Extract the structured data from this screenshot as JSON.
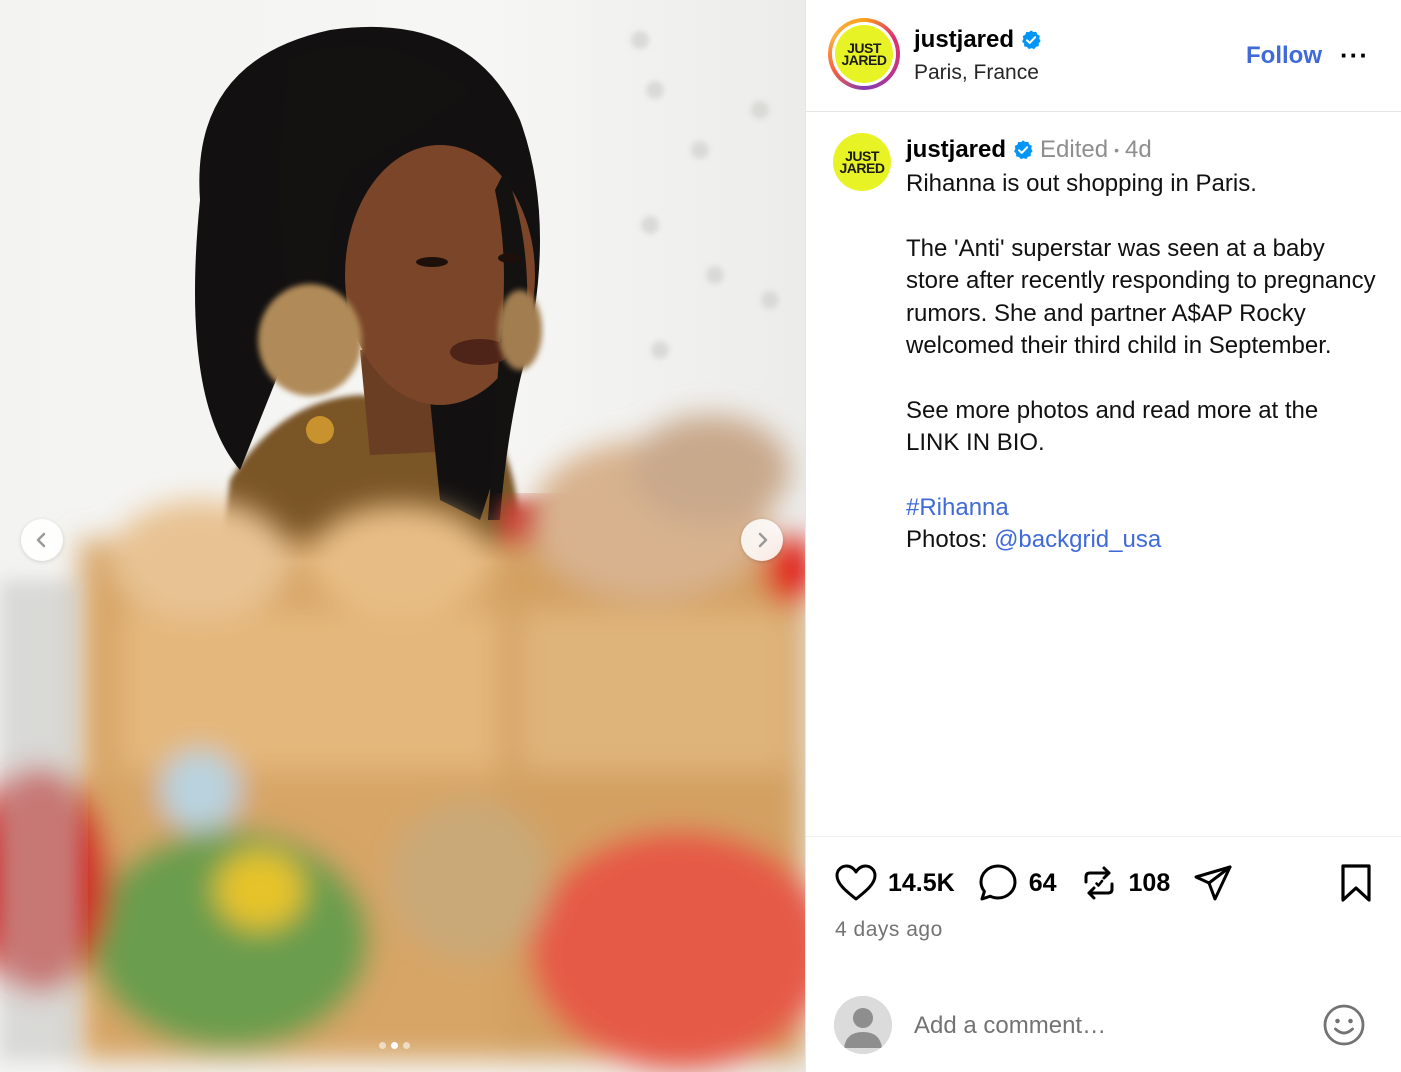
{
  "post": {
    "account": "justjared",
    "logo_text": [
      "JUST",
      "JARED"
    ],
    "location": "Paris, France",
    "follow_label": "Follow",
    "more_label": "···",
    "caption_meta_edited": "Edited",
    "caption_meta_sep": "•",
    "caption_meta_age": "4d",
    "caption_paragraphs": [
      "Rihanna is out shopping in Paris.",
      "The 'Anti' superstar was seen at a baby store after recently responding to pregnancy rumors. She and partner A$AP Rocky welcomed their third child in September.",
      "See more photos and read more at the LINK IN BIO."
    ],
    "hashtag": "#Rihanna",
    "photos_label": "Photos:",
    "photos_credit": "@backgrid_usa",
    "likes": "14.5K",
    "comments": "64",
    "reposts": "108",
    "time_ago": "4 days ago",
    "comment_placeholder": "Add a comment…"
  },
  "carousel": {
    "total_slides": 3,
    "active_slide": 2
  },
  "icons": {
    "verified": "verified-badge-icon",
    "like": "heart-icon",
    "comment": "comment-bubble-icon",
    "repost": "repost-icon",
    "share": "send-icon",
    "save": "bookmark-icon",
    "emoji": "smiley-icon",
    "prev": "chevron-left-icon",
    "next": "chevron-right-icon"
  },
  "colors": {
    "link": "#3f6ad8",
    "verified": "#0095f6",
    "logo_bg": "#e8f325",
    "muted": "#737373"
  }
}
